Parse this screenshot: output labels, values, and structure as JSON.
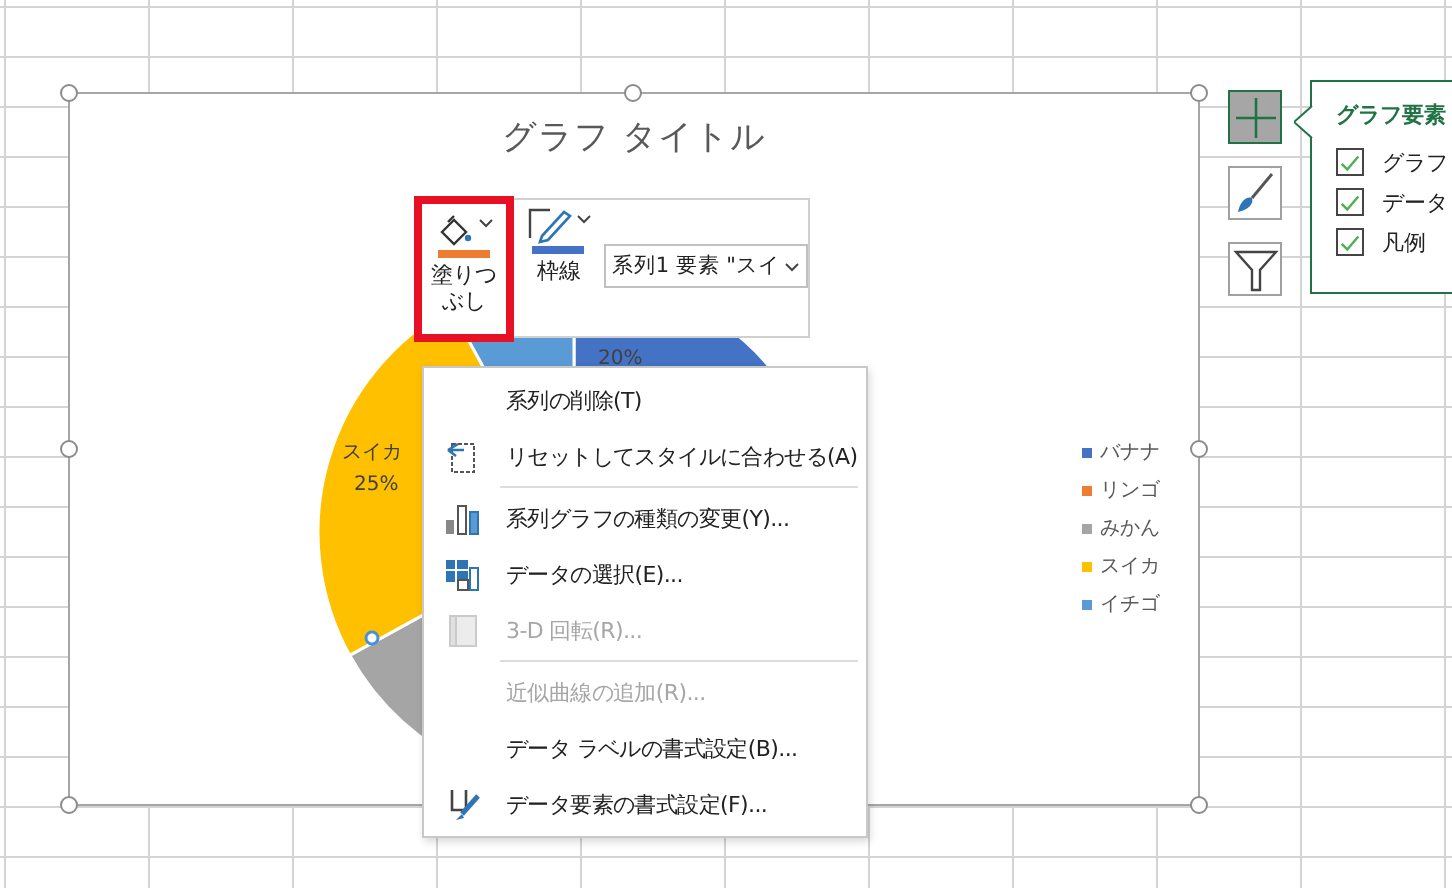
{
  "chart": {
    "title": "グラフ タイトル",
    "data_labels": [
      {
        "text": "20%"
      },
      {
        "text": "スイカ"
      },
      {
        "text": "25%"
      }
    ],
    "legend": [
      {
        "label": "バナナ",
        "color": "#4472c4"
      },
      {
        "label": "リンゴ",
        "color": "#ed7d31"
      },
      {
        "label": "みかん",
        "color": "#a5a5a5"
      },
      {
        "label": "スイカ",
        "color": "#ffc000"
      },
      {
        "label": "イチゴ",
        "color": "#5b9bd5"
      }
    ]
  },
  "mini_toolbar": {
    "fill_button": {
      "label": "塗りつぶし",
      "highlighted": true
    },
    "outline_button": {
      "label": "枠線"
    },
    "element_dropdown": {
      "value": "系列1 要素 \"スイ"
    }
  },
  "context_menu": {
    "items": [
      {
        "label": "系列の削除(T)",
        "kind": "none",
        "disabled": false,
        "separator_after": false
      },
      {
        "label": "リセットしてスタイルに合わせる(A)",
        "kind": "reset",
        "disabled": false,
        "separator_after": true
      },
      {
        "label": "系列グラフの種類の変更(Y)...",
        "kind": "chart-type",
        "disabled": false,
        "separator_after": false
      },
      {
        "label": "データの選択(E)...",
        "kind": "select-data",
        "disabled": false,
        "separator_after": false
      },
      {
        "label": "3-D 回転(R)...",
        "kind": "rotate",
        "disabled": true,
        "separator_after": true
      },
      {
        "label": "近似曲線の追加(R)...",
        "kind": "none",
        "disabled": true,
        "separator_after": false
      },
      {
        "label": "データ ラベルの書式設定(B)...",
        "kind": "none",
        "disabled": false,
        "separator_after": false
      },
      {
        "label": "データ要素の書式設定(F)...",
        "kind": "format",
        "disabled": false,
        "separator_after": false
      }
    ]
  },
  "chart_buttons": [
    {
      "kind": "elements",
      "selected": true
    },
    {
      "kind": "styles",
      "selected": false
    },
    {
      "kind": "filter",
      "selected": false
    }
  ],
  "elements_panel": {
    "title": "グラフ要素",
    "options": [
      {
        "label": "グラフ",
        "checked": true
      },
      {
        "label": "データ",
        "checked": true
      },
      {
        "label": "凡例",
        "checked": true
      }
    ]
  }
}
